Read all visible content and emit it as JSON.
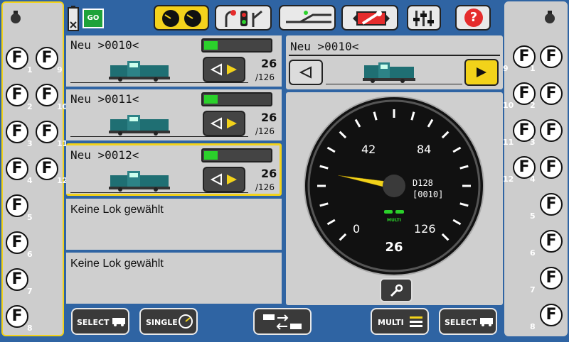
{
  "status": {
    "power_label": "GO"
  },
  "function_keys": {
    "glyph": "F",
    "left": [
      {
        "col1": "1",
        "col2": "9"
      },
      {
        "col1": "2",
        "col2": "10"
      },
      {
        "col1": "3",
        "col2": "11"
      },
      {
        "col1": "4",
        "col2": "12"
      },
      {
        "col1": "5"
      },
      {
        "col1": "6"
      },
      {
        "col1": "7"
      },
      {
        "col1": "8"
      }
    ],
    "right": [
      {
        "col1": "9",
        "col2": "1"
      },
      {
        "col1": "10",
        "col2": "2"
      },
      {
        "col1": "11",
        "col2": "3"
      },
      {
        "col1": "12",
        "col2": "4"
      },
      {
        "col2": "5"
      },
      {
        "col2": "6"
      },
      {
        "col2": "7"
      },
      {
        "col2": "8"
      }
    ]
  },
  "toolbar": {
    "items": [
      "speedometers-icon",
      "signal-turnout-icon",
      "track-layout-icon",
      "settings-wrench-icon",
      "sliders-icon",
      "help-icon"
    ],
    "help_label": "?"
  },
  "locos": [
    {
      "name": "Neu >0010<",
      "speed": "26",
      "max": "/126",
      "level": 0.21
    },
    {
      "name": "Neu >0011<",
      "speed": "26",
      "max": "/126",
      "level": 0.21
    },
    {
      "name": "Neu >0012<",
      "speed": "26",
      "max": "/126",
      "level": 0.21,
      "selected": true
    },
    {
      "empty": "Keine Lok gewählt"
    },
    {
      "empty": "Keine Lok gewählt"
    }
  ],
  "controller": {
    "name": "Neu >0010<",
    "gauge": {
      "labels": [
        "42",
        "84",
        "0",
        "126"
      ],
      "speed": "26",
      "max": 126,
      "value": 26,
      "decoder": "D128",
      "address": "[0010]",
      "mode": "MULTI"
    }
  },
  "bottom": {
    "select_left": "SELECT",
    "single": "SINGLE",
    "multi": "MULTI",
    "select_right": "SELECT"
  },
  "colors": {
    "accent": "#f2d21a",
    "background": "#2f64a3",
    "speed_bar": "#2bd12b",
    "needle": "#f2d21a"
  }
}
